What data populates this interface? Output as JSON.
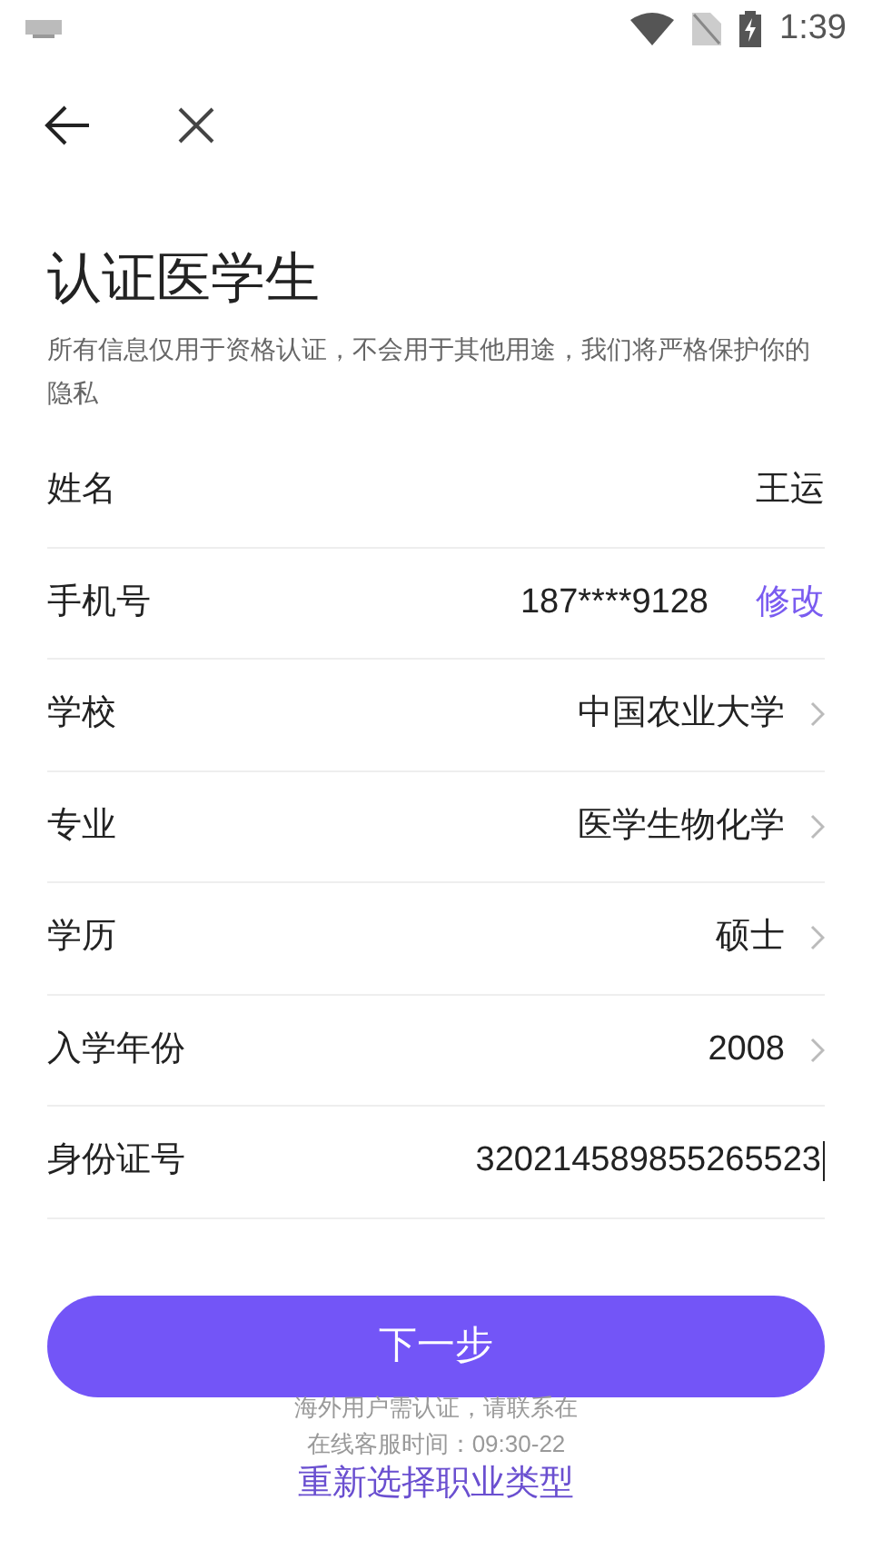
{
  "status_bar": {
    "time": "1:39"
  },
  "title": "认证医学生",
  "subtitle": "所有信息仅用于资格认证，不会用于其他用途，我们将严格保护你的隐私",
  "rows": [
    {
      "kind": "text",
      "label": "姓名",
      "value": "王运"
    },
    {
      "kind": "action",
      "label": "手机号",
      "value": "187****9128",
      "action": "修改"
    },
    {
      "kind": "select",
      "label": "学校",
      "value": "中国农业大学"
    },
    {
      "kind": "select",
      "label": "专业",
      "value": "医学生物化学"
    },
    {
      "kind": "select",
      "label": "学历",
      "value": "硕士"
    },
    {
      "kind": "select",
      "label": "入学年份",
      "value": "2008"
    },
    {
      "kind": "input",
      "label": "身份证号",
      "value": "320214589855265523"
    }
  ],
  "next_button": "下一步",
  "notes": [
    "海外用户需认证，请联系在",
    "在线客服时间：09:30-22"
  ],
  "reselect_link": "重新选择职业类型"
}
